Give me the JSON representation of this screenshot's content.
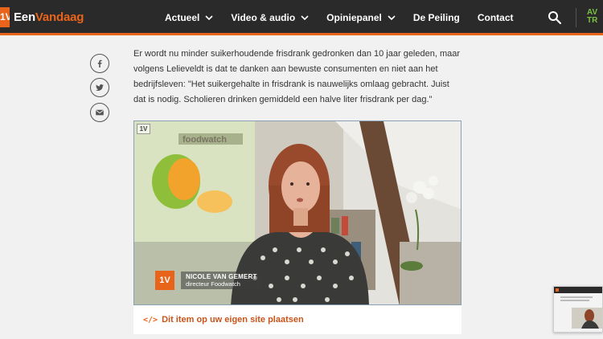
{
  "header": {
    "logo_mark": "1V",
    "logo_text_a": "Een",
    "logo_text_b": "Vandaag",
    "nav": [
      {
        "label": "Actueel",
        "dropdown": true
      },
      {
        "label": "Video & audio",
        "dropdown": true
      },
      {
        "label": "Opiniepanel",
        "dropdown": true
      },
      {
        "label": "De Peiling",
        "dropdown": false
      },
      {
        "label": "Contact",
        "dropdown": false
      }
    ],
    "corner_logo_line1": "AV",
    "corner_logo_line2": "TR",
    "accent_color": "#e8641b"
  },
  "social": [
    "facebook-icon",
    "twitter-icon",
    "mail-icon"
  ],
  "article": {
    "paragraph": "Er wordt nu minder suikerhoudende frisdrank gedronken dan 10 jaar geleden, maar volgens Lelieveldt is dat te danken aan bewuste consumenten en niet aan het bedrijfsleven: \"Het suikergehalte in frisdrank is nauwelijks omlaag gebracht. Juist dat is nodig. Scholieren drinken gemiddeld een halve liter frisdrank per dag.\""
  },
  "video": {
    "badge": "1V",
    "poster_text": "foodwatch",
    "lower_third_mark": "1V",
    "name": "NICOLE VAN GEMERT",
    "role": "directeur Foodwatch"
  },
  "embed": {
    "icon": "</>",
    "label": "Dit item op uw eigen site plaatsen"
  }
}
